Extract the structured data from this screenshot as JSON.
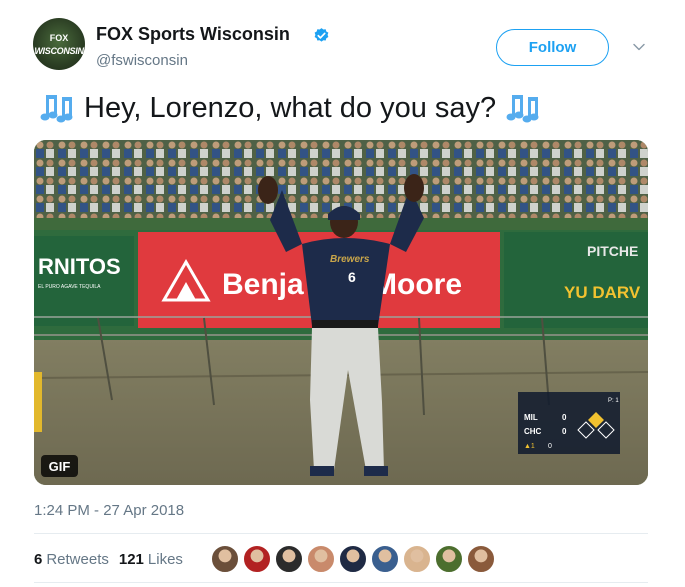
{
  "account": {
    "name": "FOX Sports Wisconsin",
    "handle": "@fswisconsin",
    "avatar_line1": "FOX",
    "avatar_line2": "WISCONSIN",
    "verified": true,
    "verified_icon": "verified-badge-icon"
  },
  "actions": {
    "follow_label": "Follow",
    "menu_icon": "chevron-down-icon"
  },
  "tweet": {
    "text": "Hey, Lorenzo, what do you say?",
    "emoji_icon": "musical-notes-icon"
  },
  "media": {
    "type": "animated-gif",
    "badge": "GIF",
    "scene_signs": {
      "left_sign": "RNITOS",
      "left_sign_sub": "EL PURO AGAVE TEQUILA",
      "center_sign_left": "Benja",
      "center_sign_right": "Moore",
      "right_sign_top": "PITCHE",
      "right_sign_bottom": "YU DARV",
      "jersey_script": "Brewers",
      "jersey_number": "6"
    },
    "scorebug": {
      "away": "MIL",
      "away_score": "0",
      "home": "CHC",
      "home_score": "0",
      "inning": "▲1",
      "count": "0",
      "top_right": "P: 1"
    }
  },
  "meta": {
    "timestamp": "1:24 PM - 27 Apr 2018"
  },
  "stats": {
    "retweets_count": "6",
    "retweets_label": "Retweets",
    "likes_count": "121",
    "likes_label": "Likes"
  },
  "likers": [
    {
      "name": "liker-avatar-1",
      "color": "#6b4f3a"
    },
    {
      "name": "liker-avatar-2",
      "color": "#b22222"
    },
    {
      "name": "liker-avatar-3",
      "color": "#2b2b2b"
    },
    {
      "name": "liker-avatar-4",
      "color": "#c98a6b"
    },
    {
      "name": "liker-avatar-5",
      "color": "#1f2a44"
    },
    {
      "name": "liker-avatar-6",
      "color": "#3a5f8f"
    },
    {
      "name": "liker-avatar-7",
      "color": "#d9b48f"
    },
    {
      "name": "liker-avatar-8",
      "color": "#4c6e2e"
    },
    {
      "name": "liker-avatar-9",
      "color": "#8a5a3b"
    }
  ],
  "colors": {
    "accent": "#1da1f2",
    "secondary_text": "#657786",
    "primary_text": "#14171a",
    "divider": "#e6ecf0"
  }
}
